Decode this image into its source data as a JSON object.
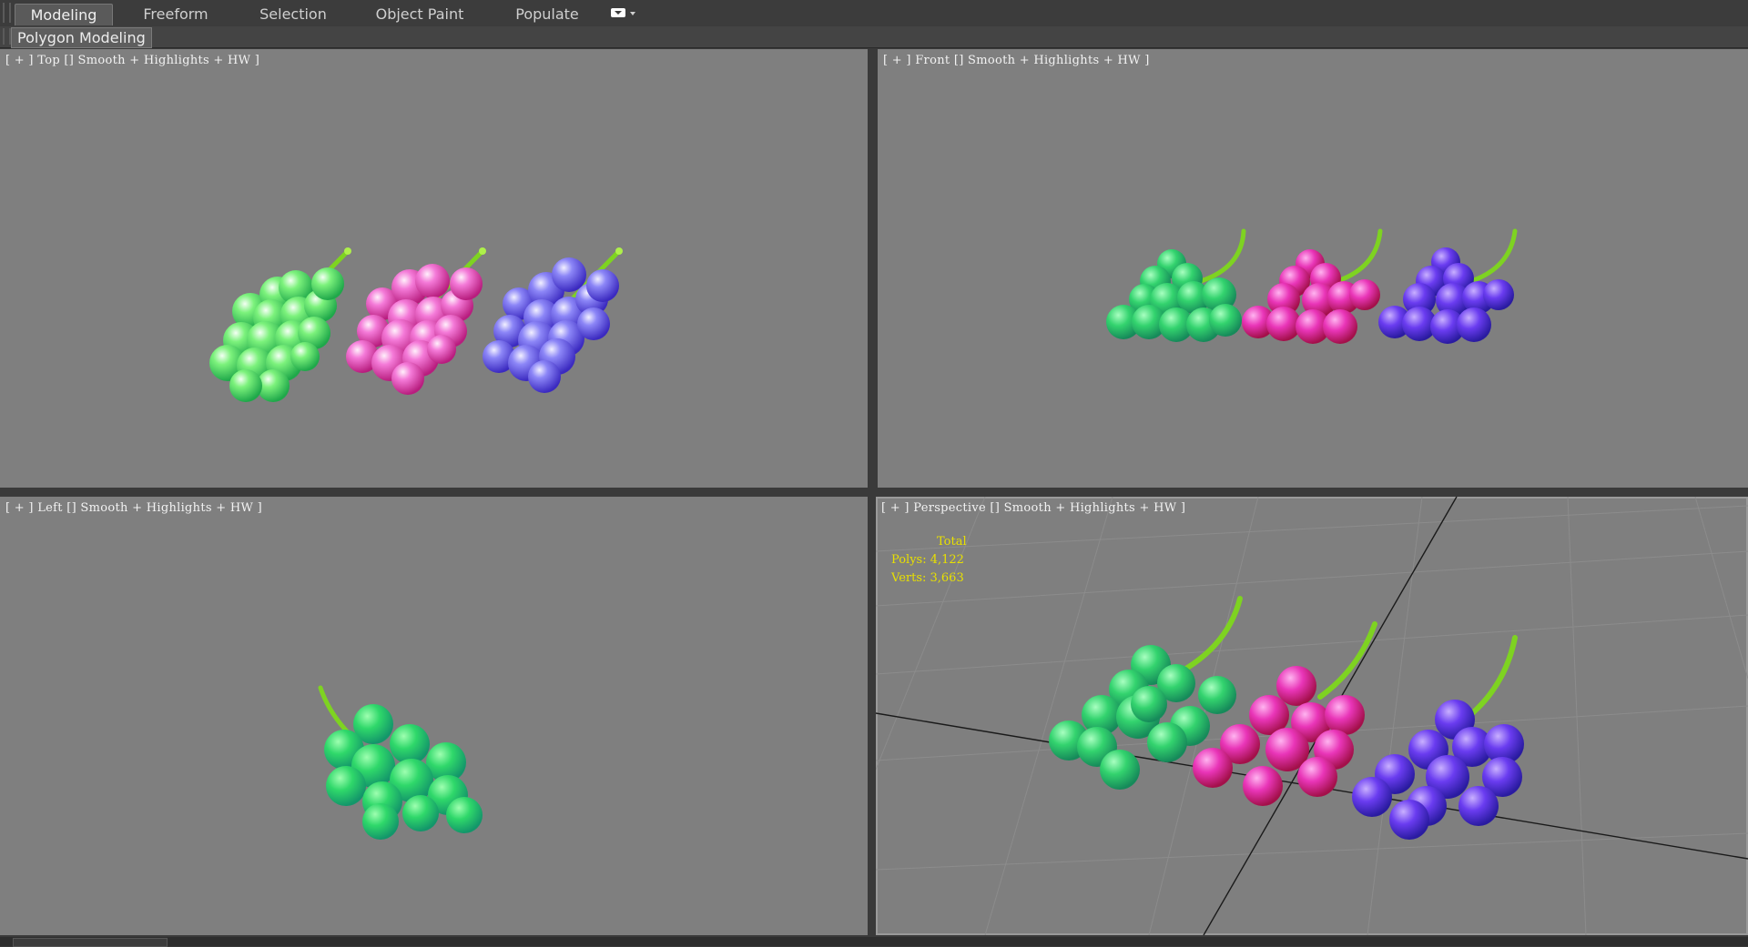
{
  "ribbon": {
    "tabs": [
      {
        "label": "Modeling",
        "active": true
      },
      {
        "label": "Freeform",
        "active": false
      },
      {
        "label": "Selection",
        "active": false
      },
      {
        "label": "Object Paint",
        "active": false
      },
      {
        "label": "Populate",
        "active": false
      }
    ],
    "panel_label": "Polygon Modeling",
    "more_icon": "options-dropdown-icon"
  },
  "viewports": {
    "top": {
      "label": "[ + ] Top [] Smooth + Highlights + HW ]"
    },
    "front": {
      "label": "[ + ] Front [] Smooth + Highlights + HW ]"
    },
    "left": {
      "label": "[ + ] Left [] Smooth + Highlights + HW ]"
    },
    "perspective": {
      "label": "[ + ] Perspective [] Smooth + Highlights + HW ]",
      "stats": {
        "title": "Total",
        "polys": "Polys: 4,122",
        "verts": "Verts: 3,663"
      }
    }
  },
  "colors": {
    "viewport_bg": "#7f7f7f",
    "grape_green": "#36e07a",
    "grape_pink": "#f04fc6",
    "grape_purple": "#6a3cf0",
    "stem": "#7ed321",
    "stats_text": "#e8e000"
  }
}
